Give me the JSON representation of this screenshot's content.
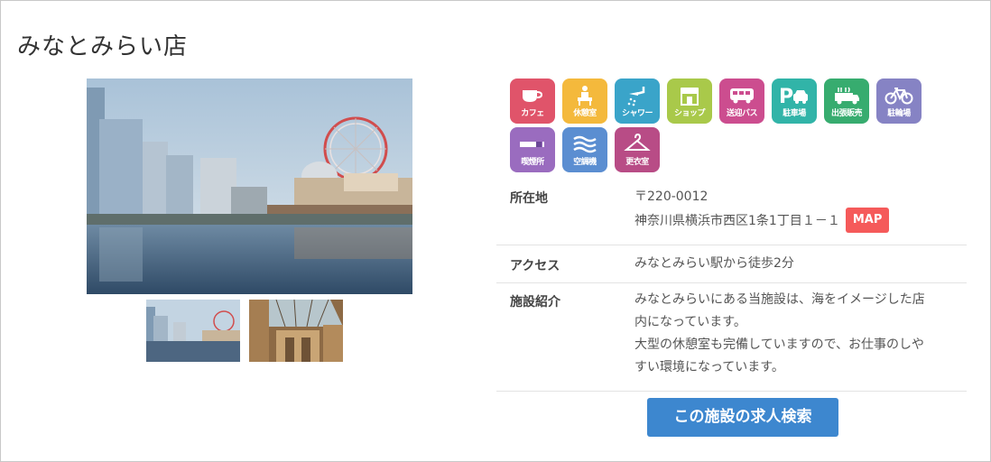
{
  "page": {
    "title": "みなとみらい店"
  },
  "amenities": [
    {
      "icon": "cafe-cup-icon",
      "label": "カフェ",
      "color": "#e0546a"
    },
    {
      "icon": "lounge-icon",
      "label": "休憩室",
      "color": "#f4b93c"
    },
    {
      "icon": "shower-icon",
      "label": "シャワー",
      "color": "#3aa4c9"
    },
    {
      "icon": "shop-icon",
      "label": "ショップ",
      "color": "#a9c94a"
    },
    {
      "icon": "bus-icon",
      "label": "送迎バス",
      "color": "#cc4d8f"
    },
    {
      "icon": "parking-icon",
      "label": "駐車場",
      "color": "#31b4a8"
    },
    {
      "icon": "food-truck-icon",
      "label": "出張販売",
      "color": "#37ac6f"
    },
    {
      "icon": "bicycle-icon",
      "label": "駐輪場",
      "color": "#8683c4"
    },
    {
      "icon": "smoking-icon",
      "label": "喫煙所",
      "color": "#9a6cbf"
    },
    {
      "icon": "air-conditioner-icon",
      "label": "空調機",
      "color": "#5b8ed1"
    },
    {
      "icon": "hanger-icon",
      "label": "更衣室",
      "color": "#b84c86"
    }
  ],
  "info": {
    "address_label": "所在地",
    "postal_code": "〒220-0012",
    "address": "神奈川県横浜市西区1条1丁目１－１",
    "map_button": "MAP",
    "access_label": "アクセス",
    "access": "みなとみらい駅から徒歩2分",
    "intro_label": "施設紹介",
    "intro_line1": "みなとみらいにある当施設は、海をイメージした店",
    "intro_line2": "内になっています。",
    "intro_line3": "大型の休憩室も完備していますので、お仕事のしや",
    "intro_line4": "すい環境になっています。"
  },
  "search_button": "この施設の求人検索",
  "colors": {
    "map_button": "#f55a5a",
    "search_button": "#3d87cf"
  }
}
